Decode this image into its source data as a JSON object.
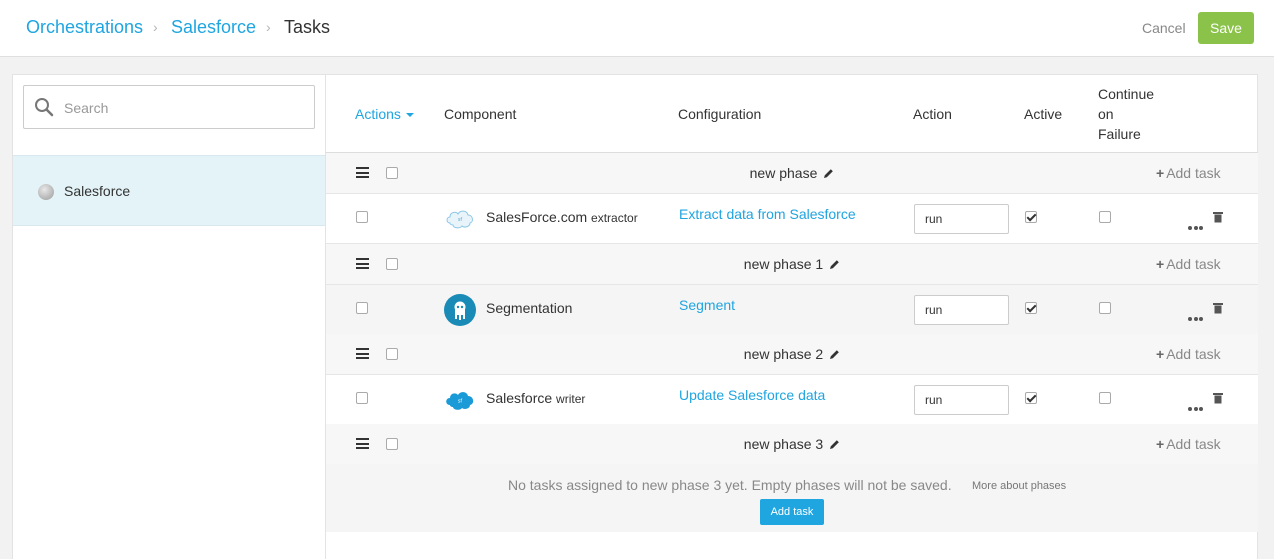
{
  "breadcrumb": {
    "items": [
      "Orchestrations",
      "Salesforce"
    ],
    "current": "Tasks"
  },
  "header_actions": {
    "cancel_label": "Cancel",
    "save_label": "Save"
  },
  "colors": {
    "accent": "#1fa5e0",
    "save": "#8bc34a"
  },
  "sidebar": {
    "search_placeholder": "Search",
    "items": [
      {
        "label": "Salesforce"
      }
    ]
  },
  "table": {
    "actions_label": "Actions",
    "headers": [
      "Component",
      "Configuration",
      "Action",
      "Active",
      "Continue",
      "on",
      "Failure"
    ],
    "add_task_label": "Add task",
    "phases": [
      {
        "name": "new phase",
        "task": {
          "component": "SalesForce.com",
          "component_suffix": "extractor",
          "icon": "salesforce-extractor-icon",
          "configuration": "Extract data from Salesforce",
          "action": "run",
          "active": true,
          "continue_on_failure": false
        }
      },
      {
        "name": "new phase 1",
        "task": {
          "component": "Segmentation",
          "component_suffix": "",
          "icon": "segmentation-icon",
          "configuration": "Segment",
          "action": "run",
          "active": true,
          "continue_on_failure": false
        }
      },
      {
        "name": "new phase 2",
        "task": {
          "component": "Salesforce",
          "component_suffix": "writer",
          "icon": "salesforce-writer-icon",
          "configuration": "Update Salesforce data",
          "action": "run",
          "active": true,
          "continue_on_failure": false
        }
      },
      {
        "name": "new phase 3"
      }
    ],
    "empty_phase": {
      "message": "No tasks assigned to new phase 3 yet. Empty phases will not be saved.",
      "more_link": "More about phases",
      "button": "Add task"
    }
  }
}
